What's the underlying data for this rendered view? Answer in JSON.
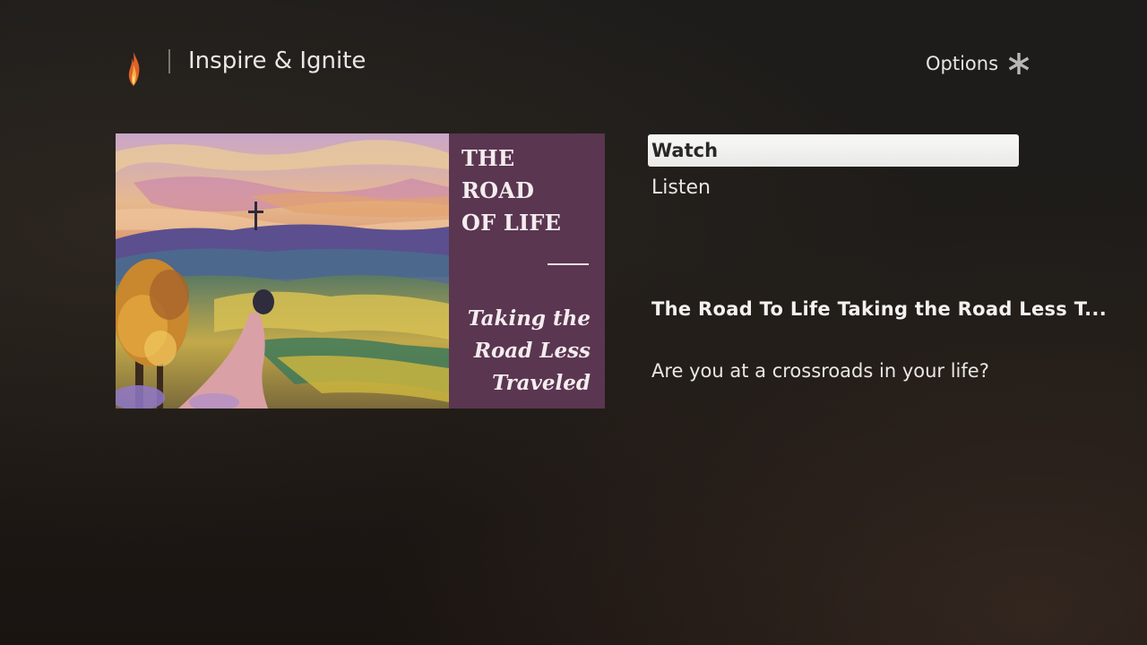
{
  "header": {
    "app_title": "Inspire & Ignite",
    "logo_icon": "flame-icon",
    "options_label": "Options",
    "options_icon": "asterisk-icon"
  },
  "artwork": {
    "title_lines": [
      "THE",
      "ROAD",
      "OF LIFE"
    ],
    "subtitle_lines": [
      "Taking the",
      "Road Less",
      "Traveled"
    ],
    "panel_color": "#5a3650"
  },
  "menu": {
    "items": [
      {
        "label": "Watch",
        "selected": true
      },
      {
        "label": "Listen",
        "selected": false
      }
    ]
  },
  "episode": {
    "title": "The Road To Life Taking the Road Less T...",
    "description": "Are you at a crossroads in your life?"
  },
  "colors": {
    "selection_background": "#f2f2f1",
    "text_primary": "#ececec"
  }
}
